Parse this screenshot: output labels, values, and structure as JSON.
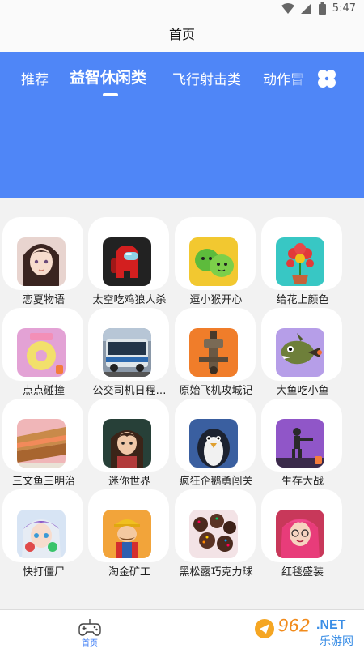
{
  "status_bar": {
    "time": "5:47",
    "icons": [
      "wifi-icon",
      "signal-icon",
      "battery-icon"
    ]
  },
  "header": {
    "title": "首页"
  },
  "category_tabs": [
    {
      "label": "推荐",
      "active": false
    },
    {
      "label": "益智休闲类",
      "active": true
    },
    {
      "label": "飞行射击类",
      "active": false
    },
    {
      "label": "动作冒",
      "active": false
    }
  ],
  "more_categories_icon": "flower-grid-icon",
  "games": [
    {
      "name": "恋夏物语"
    },
    {
      "name": "太空吃鸡狼人杀"
    },
    {
      "name": "逗小猴开心"
    },
    {
      "name": "给花上颜色"
    },
    {
      "name": "点点碰撞"
    },
    {
      "name": "公交司机日程…"
    },
    {
      "name": "原始飞机攻城记"
    },
    {
      "name": "大鱼吃小鱼"
    },
    {
      "name": "三文鱼三明治"
    },
    {
      "name": "迷你世界"
    },
    {
      "name": "疯狂企鹅勇闯关"
    },
    {
      "name": "生存大战"
    },
    {
      "name": "快打僵尸"
    },
    {
      "name": "淘金矿工"
    },
    {
      "name": "黑松露巧克力球"
    },
    {
      "name": "红毯盛装"
    }
  ],
  "bottom_nav": [
    {
      "label": "首页",
      "icon": "gamepad-icon",
      "active": true
    }
  ],
  "watermark": {
    "brand": "962.NET",
    "sub": "乐游网"
  },
  "colors": {
    "accent": "#4f86f7",
    "nav_active": "#3b7bf6",
    "background": "#f2f2f2"
  }
}
